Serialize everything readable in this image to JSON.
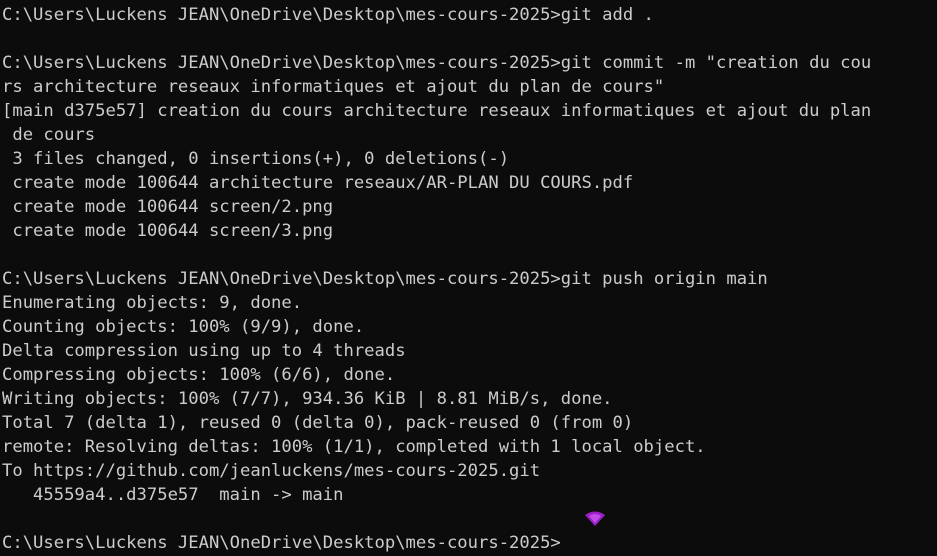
{
  "terminal": {
    "lines": [
      "C:\\Users\\Luckens JEAN\\OneDrive\\Desktop\\mes-cours-2025>git add .",
      "",
      "C:\\Users\\Luckens JEAN\\OneDrive\\Desktop\\mes-cours-2025>git commit -m \"creation du cou",
      "rs architecture reseaux informatiques et ajout du plan de cours\"",
      "[main d375e57] creation du cours architecture reseaux informatiques et ajout du plan",
      " de cours",
      " 3 files changed, 0 insertions(+), 0 deletions(-)",
      " create mode 100644 architecture reseaux/AR-PLAN DU COURS.pdf",
      " create mode 100644 screen/2.png",
      " create mode 100644 screen/3.png",
      "",
      "C:\\Users\\Luckens JEAN\\OneDrive\\Desktop\\mes-cours-2025>git push origin main",
      "Enumerating objects: 9, done.",
      "Counting objects: 100% (9/9), done.",
      "Delta compression using up to 4 threads",
      "Compressing objects: 100% (6/6), done.",
      "Writing objects: 100% (7/7), 934.36 KiB | 8.81 MiB/s, done.",
      "Total 7 (delta 1), reused 0 (delta 0), pack-reused 0 (from 0)",
      "remote: Resolving deltas: 100% (1/1), completed with 1 local object.",
      "To https://github.com/jeanluckens/mes-cours-2025.git",
      "   45559a4..d375e57  main -> main",
      "",
      "C:\\Users\\Luckens JEAN\\OneDrive\\Desktop\\mes-cours-2025>"
    ]
  },
  "colors": {
    "background": "#0c0c0c",
    "text": "#cccccc",
    "cursor_overlay": "#9b1fc8"
  },
  "icons": {
    "cursor_overlay": "wifi-signal-icon"
  }
}
